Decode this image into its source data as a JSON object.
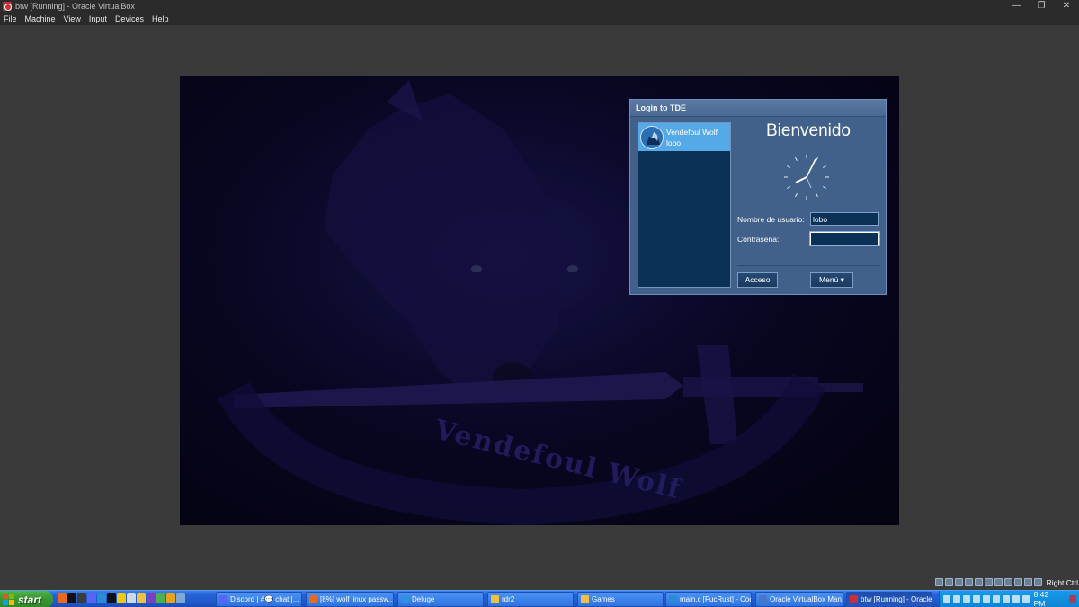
{
  "window": {
    "title": "btw [Running] - Oracle VirtualBox",
    "controls": [
      "—",
      "❐",
      "✕"
    ]
  },
  "menubar": [
    "File",
    "Machine",
    "View",
    "Input",
    "Devices",
    "Help"
  ],
  "login": {
    "title": "Login to TDE",
    "user": {
      "name": "Vendefoul Wolf",
      "login": "lobo"
    },
    "welcome": "Bienvenido",
    "username_label": "Nombre de usuario:",
    "username_value": "lobo",
    "password_label": "Contraseña:",
    "password_value": "",
    "login_button": "Acceso",
    "menu_button": "Menú ▾"
  },
  "wallpaper_text": "Vendefoul Wolf",
  "host_status": {
    "right_ctrl": "Right Ctrl"
  },
  "taskbar": {
    "start_label": "start",
    "tasks": [
      "Discord | #💬 chat |...",
      "[8%] wolf linux passw...",
      "Deluge",
      "rdr2",
      "Games",
      "main.c [FucRust] - Cod...",
      "Oracle VirtualBox Man...",
      "btw [Running] - Oracle..."
    ],
    "clock": "8:42 PM"
  },
  "colors": {
    "dialog": "#41608a",
    "user_highlight": "#54a9e6",
    "taskbar": "#2259cc",
    "start_green": "#3a9a33"
  }
}
